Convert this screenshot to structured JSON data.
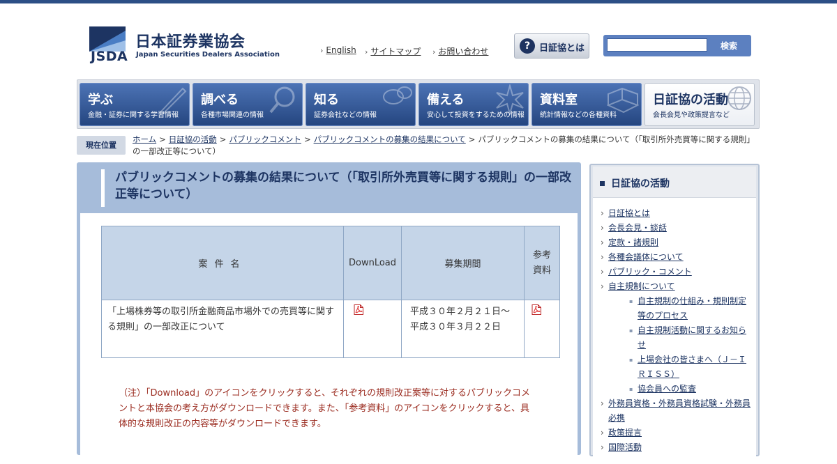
{
  "header": {
    "logo_ja": "日本証券業協会",
    "logo_en": "Japan Securities Dealers Association",
    "logo_abbr": "JSDA",
    "links": [
      {
        "label": "English"
      },
      {
        "label": "サイトマップ"
      },
      {
        "label": "お問い合わせ"
      }
    ],
    "about_button": "日証協とは",
    "search_button": "検索",
    "search_value": ""
  },
  "nav": [
    {
      "title": "学ぶ",
      "sub": "金融・証券に関する学習情報",
      "active": false
    },
    {
      "title": "調べる",
      "sub": "各種市場関連の情報",
      "active": false
    },
    {
      "title": "知る",
      "sub": "証券会社などの情報",
      "active": false
    },
    {
      "title": "備える",
      "sub": "安心して投資をするための情報",
      "active": false
    },
    {
      "title": "資料室",
      "sub": "統計情報などの各種資料",
      "active": false
    },
    {
      "title": "日証協の活動",
      "sub": "会長会見や政策提言など",
      "active": true
    }
  ],
  "breadcrumb": {
    "label": "現在位置",
    "items": [
      "ホーム",
      "日証協の活動",
      "パブリックコメント",
      "パブリックコメントの募集の結果について"
    ],
    "current": "パブリックコメントの募集の結果について（「取引所外売買等に関する規則」の一部改正等について）"
  },
  "main": {
    "title": "パブリックコメントの募集の結果について（「取引所外売買等に関する規則」の一部改正等について）",
    "table": {
      "headers": {
        "name": "案件名",
        "download": "DownLoad",
        "period": "募集期間",
        "reference": "参考資料"
      },
      "rows": [
        {
          "name": "「上場株券等の取引所金融商品市場外での売買等に関する規則」の一部改正について",
          "period": "平成３０年２月２１日～平成３０年３月２２日"
        }
      ]
    },
    "note": "（注）「Download」のアイコンをクリックすると、それぞれの規則改正案等に対するパブリックコメントと本協会の考え方がダウンロードできます。また、「参考資料」のアイコンをクリックすると、具体的な規則改正の内容等がダウンロードできます。"
  },
  "sidebar": {
    "title": "日証協の活動",
    "items": [
      {
        "label": "日証協とは"
      },
      {
        "label": "会長会見・談話"
      },
      {
        "label": "定款・諸規則"
      },
      {
        "label": "各種会議体について"
      },
      {
        "label": "パブリック・コメント"
      },
      {
        "label": "自主規制について"
      }
    ],
    "sub_items": [
      {
        "label": "自主規制の仕組み・規則制定等のプロセス"
      },
      {
        "label": "自主規制活動に関するお知らせ"
      },
      {
        "label": "上場会社の皆さまへ（Ｊ－ＩＲＩＳＳ）"
      },
      {
        "label": "協会員への監査"
      }
    ],
    "items_after": [
      {
        "label": "外務員資格・外務員資格試験・外務員必携"
      },
      {
        "label": "政策提言"
      },
      {
        "label": "国際活動"
      }
    ]
  },
  "colors": {
    "brand": "#1d3462",
    "nav_blue": "#2c4f86",
    "panel": "#a6bcda",
    "note_red": "#9a2a1e"
  },
  "icons": [
    "question-icon",
    "chevron-right-icon",
    "pdf-icon",
    "square-bullet-icon"
  ]
}
